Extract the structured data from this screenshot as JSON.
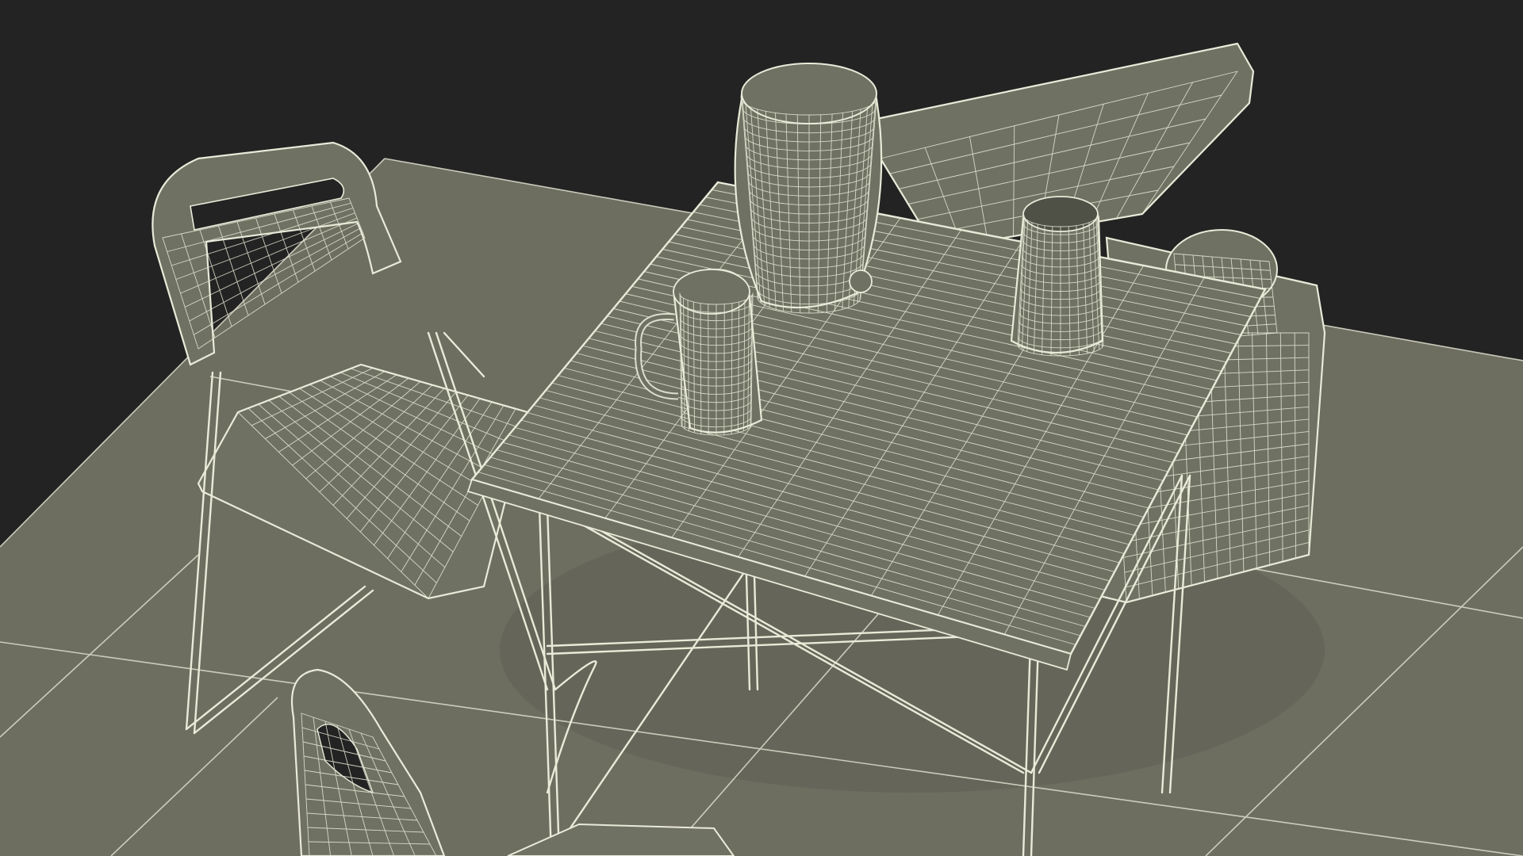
{
  "scene": {
    "description_visible_text": "",
    "colors": {
      "background": "#232323",
      "floor": "#6d6e60",
      "floor_shadow": "#5f6054",
      "wire": "#e9ead8",
      "grid_line": "#d6d7c6"
    },
    "objects": [
      {
        "name": "floor-plane",
        "kind": "plane"
      },
      {
        "name": "folding-table",
        "kind": "furniture"
      },
      {
        "name": "folding-chair-left",
        "kind": "furniture"
      },
      {
        "name": "folding-chair-front",
        "kind": "furniture"
      },
      {
        "name": "beer-keg",
        "kind": "container"
      },
      {
        "name": "beer-mug-left",
        "kind": "mug"
      },
      {
        "name": "beer-mug-right",
        "kind": "mug"
      },
      {
        "name": "cooler-box",
        "kind": "container"
      },
      {
        "name": "cooler-lid",
        "kind": "container"
      }
    ]
  }
}
